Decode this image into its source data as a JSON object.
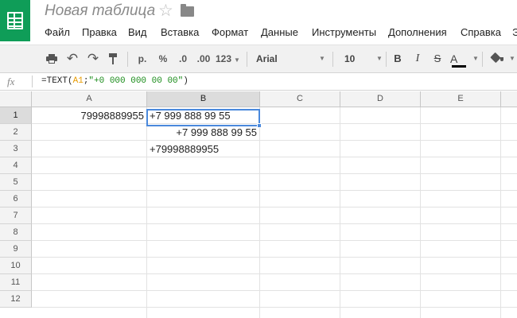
{
  "app": {
    "title": "Новая таблица"
  },
  "menu": [
    "Файл",
    "Правка",
    "Вид",
    "Вставка",
    "Формат",
    "Данные",
    "Инструменты",
    "Дополнения",
    "Справка",
    "Э"
  ],
  "toolbar": {
    "currency_label": "р.",
    "percent_label": "%",
    "decrease_decimals_label": ".0",
    "increase_decimals_label": ".00",
    "number_format_label": "123",
    "font": "Arial",
    "font_size": "10",
    "bold_label": "B",
    "italic_label": "I",
    "strike_label": "S",
    "text_color_label": "A",
    "text_color": "#000000"
  },
  "formula_bar": {
    "fx_label": "fx",
    "prefix": "=TEXT(",
    "ref": "A1",
    "mid": ";",
    "string": "\"+0 000 000 00 00\"",
    "suffix": ")"
  },
  "grid": {
    "columns": [
      "A",
      "B",
      "C",
      "D",
      "E"
    ],
    "rows": [
      "1",
      "2",
      "3",
      "4",
      "5",
      "6",
      "7",
      "8",
      "9",
      "10",
      "11",
      "12"
    ],
    "selected_column": "B",
    "selected_row": "1",
    "cells": {
      "A1": "79998889955",
      "B1": "+7 999 888 99 55",
      "B2": "+7 999 888 99 55",
      "B3": "+79998889955"
    }
  },
  "colors": {
    "brand": "#0f9d58",
    "selection": "#4a89dc",
    "formula_ref": "#e89b00",
    "formula_string": "#1a8c1a"
  }
}
